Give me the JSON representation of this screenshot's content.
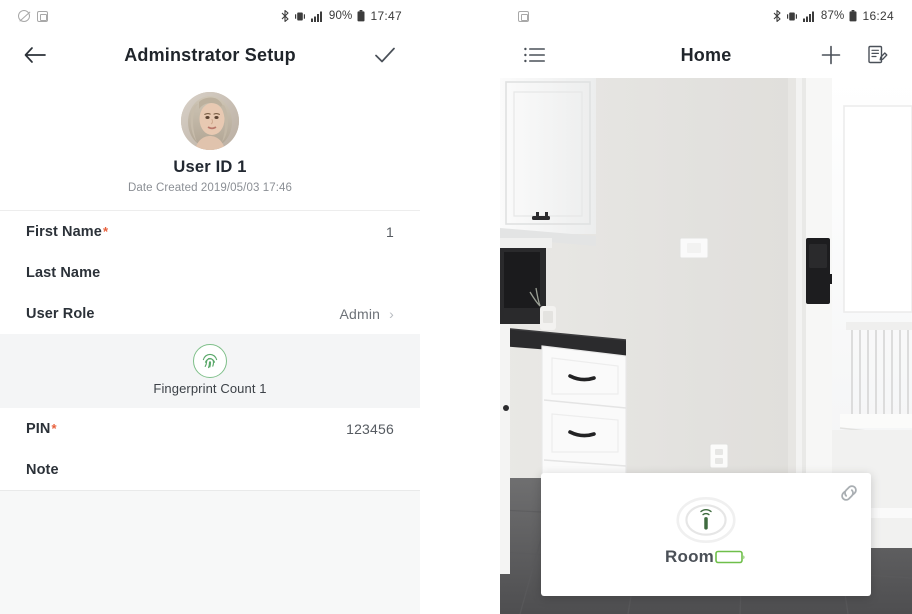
{
  "screens": {
    "left": {
      "status_bar": {
        "icons_left": [
          "do-not-disturb-icon",
          "screenshot-icon"
        ],
        "bluetooth_icon": "bluetooth-icon",
        "vibrate_icon": "vibrate-icon",
        "signal_icon": "signal-bars-icon",
        "battery_percent": "90%",
        "battery_icon": "battery-icon",
        "time": "17:47"
      },
      "appbar": {
        "back_icon": "back-arrow-icon",
        "title": "Adminstrator Setup",
        "confirm_icon": "checkmark-icon"
      },
      "profile": {
        "avatar": "user-avatar",
        "name": "User ID 1",
        "date_created": "Date Created 2019/05/03 17:46"
      },
      "fields": [
        {
          "label": "First Name",
          "required": "*",
          "value": "1"
        },
        {
          "label": "Last Name",
          "required": "",
          "value": ""
        },
        {
          "label": "User Role",
          "required": "",
          "value": "Admin",
          "chevron": "›"
        }
      ],
      "fingerprint": {
        "icon": "fingerprint-icon",
        "caption": "Fingerprint Count 1",
        "accent_color": "#7fc08a"
      },
      "fields_lower": [
        {
          "label": "PIN",
          "required": "*",
          "value": "123456"
        },
        {
          "label": "Note",
          "required": "",
          "value": ""
        }
      ],
      "required_marker_color": "#e8603c"
    },
    "right": {
      "status_bar": {
        "icons_left": [
          "screenshot-icon"
        ],
        "bluetooth_icon": "bluetooth-icon",
        "vibrate_icon": "vibrate-icon",
        "signal_icon": "signal-bars-icon",
        "battery_percent": "87%",
        "battery_icon": "battery-icon",
        "time": "16:24"
      },
      "appbar": {
        "menu_icon": "list-menu-icon",
        "title": "Home",
        "add_icon": "plus-icon",
        "records_icon": "document-edit-icon"
      },
      "scene": {
        "description": "room-photo"
      },
      "device_card": {
        "link_icon": "chain-link-icon",
        "lock_icon": "lock-signal-icon",
        "name": "Room",
        "battery_icon": "battery-icon",
        "battery_color": "#6fbf4a"
      }
    }
  }
}
